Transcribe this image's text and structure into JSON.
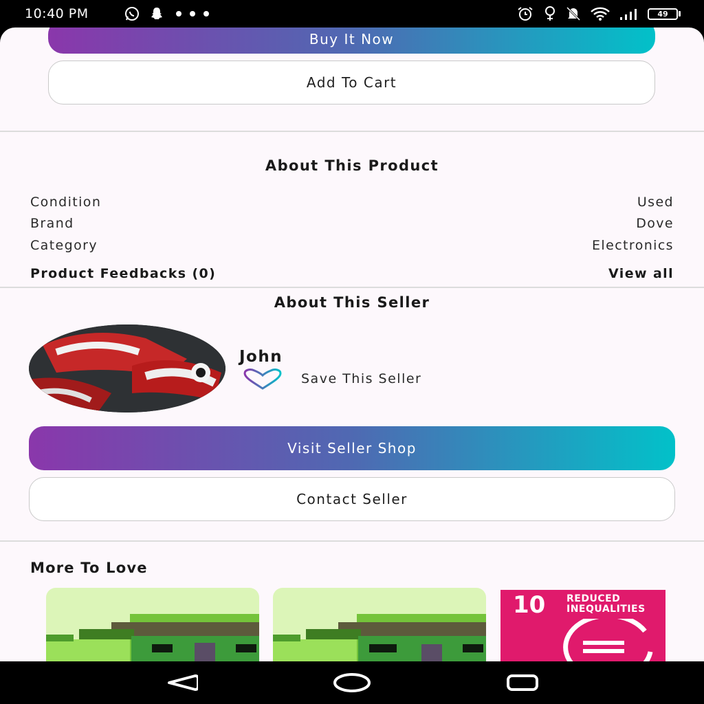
{
  "status_bar": {
    "time": "10:40 PM",
    "left_icons": [
      "whatsapp-icon",
      "snapchat-icon",
      "more-dots-icon"
    ],
    "right_icons": [
      "alarm-icon",
      "location-icon",
      "mute-icon",
      "wifi-icon",
      "signal-icon"
    ],
    "battery": "49"
  },
  "actions": {
    "buy_now": "Buy It Now",
    "add_to_cart": "Add To Cart"
  },
  "about_product": {
    "title": "About This Product",
    "specs": [
      {
        "label": "Condition",
        "value": "Used"
      },
      {
        "label": "Brand",
        "value": "Dove"
      },
      {
        "label": "Category",
        "value": "Electronics"
      }
    ],
    "feedbacks_label": "Product Feedbacks (0)",
    "view_all": "View all"
  },
  "about_seller": {
    "title": "About This Seller",
    "name": "John",
    "save_label": "Save This Seller",
    "visit_shop": "Visit Seller Shop",
    "contact": "Contact Seller"
  },
  "more_to_love": {
    "title": "More To Love",
    "sdg_card": {
      "number": "10",
      "text": "REDUCED\nINEQUALITIES"
    }
  },
  "colors": {
    "gradient_start": "#8a37ab",
    "gradient_end": "#02c1c9",
    "sdg_pink": "#e01a6c",
    "background": "#fdf8fc"
  },
  "nav_bar": {
    "icons": [
      "back-icon",
      "home-icon",
      "recents-icon"
    ]
  }
}
